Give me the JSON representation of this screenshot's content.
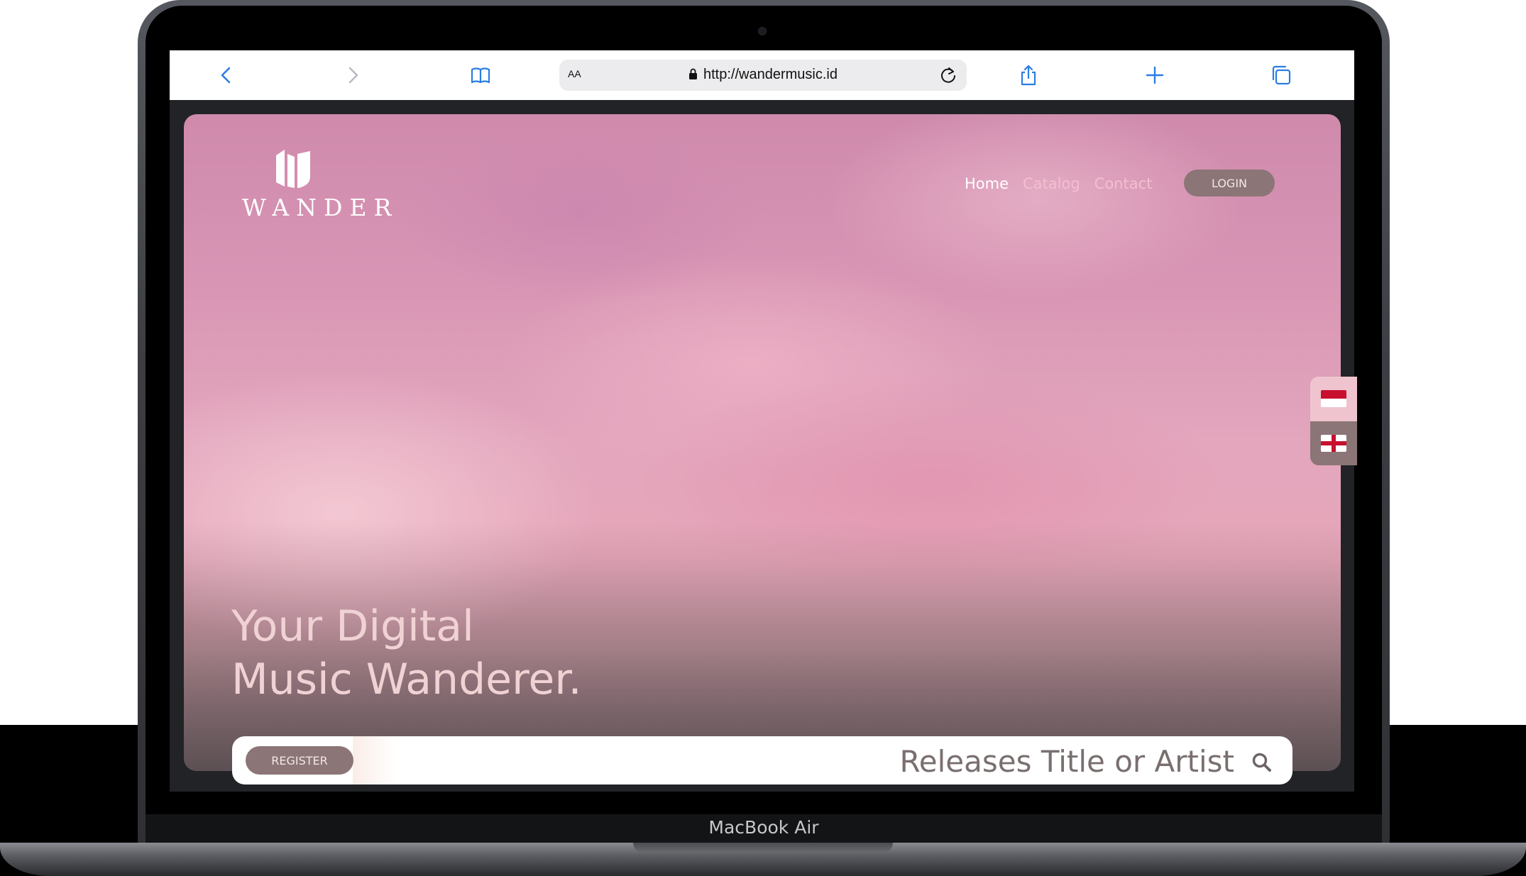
{
  "device": {
    "label": "MacBook Air"
  },
  "browser": {
    "text_size_label": "AA",
    "url": "http://wandermusic.id",
    "icons": [
      "back-icon",
      "forward-icon",
      "bookmarks-icon",
      "lock-icon",
      "reload-icon",
      "share-icon",
      "new-tab-icon",
      "tabs-icon"
    ]
  },
  "site": {
    "logo_text": "WANDER",
    "nav": [
      {
        "label": "Home",
        "active": true
      },
      {
        "label": "Catalog",
        "active": false
      },
      {
        "label": "Contact",
        "active": false
      }
    ],
    "login_label": "LOGIN",
    "hero_line1": "Your Digital",
    "hero_line2": "Music Wanderer.",
    "register_label": "REGISTER",
    "search_placeholder": "Releases Title or Artist",
    "languages": [
      "Indonesia flag",
      "England flag"
    ]
  },
  "colors": {
    "accent_button": "#8b7576",
    "nav_active": "#ffffff",
    "nav_inactive": "#f3bfd1",
    "hero_text": "#f1d2d4",
    "browser_icon": "#2a7de1"
  }
}
